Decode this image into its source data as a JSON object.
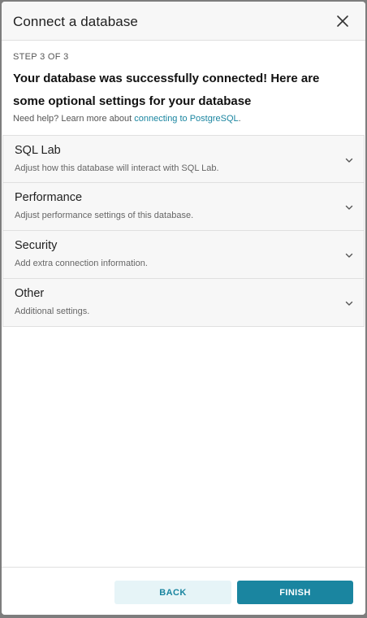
{
  "modal": {
    "title": "Connect a database",
    "close_icon": "close-icon"
  },
  "step": {
    "label": "STEP 3 OF 3"
  },
  "headline": "Your database was successfully connected! Here are some optional settings for your database",
  "help": {
    "prefix": "Need help? Learn more about ",
    "link_text": "connecting to PostgreSQL",
    "suffix": "."
  },
  "panels": [
    {
      "title": "SQL Lab",
      "description": "Adjust how this database will interact with SQL Lab."
    },
    {
      "title": "Performance",
      "description": "Adjust performance settings of this database."
    },
    {
      "title": "Security",
      "description": "Add extra connection information."
    },
    {
      "title": "Other",
      "description": "Additional settings."
    }
  ],
  "footer": {
    "back_label": "BACK",
    "finish_label": "FINISH"
  },
  "colors": {
    "accent": "#1a85a0",
    "accent_light": "#e6f4f7",
    "panel_bg": "#f7f7f7"
  }
}
